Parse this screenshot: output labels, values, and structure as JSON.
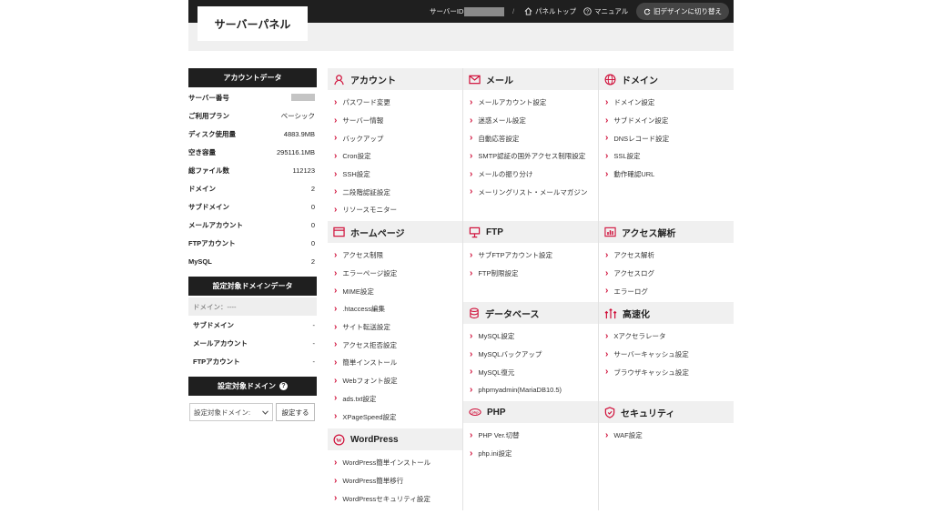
{
  "header": {
    "logo": "サーバーパネル",
    "server_id_label": "サーバーID",
    "separator": "/",
    "panel_top": "パネルトップ",
    "manual": "マニュアル",
    "old_design": "旧デザインに切り替え"
  },
  "sidebar": {
    "account_title": "アカウントデータ",
    "account_rows": [
      {
        "k": "サーバー番号",
        "v": ""
      },
      {
        "k": "ご利用プラン",
        "v": "ベーシック"
      },
      {
        "k": "ディスク使用量",
        "v": "4883.9MB"
      },
      {
        "k": "空き容量",
        "v": "295116.1MB"
      },
      {
        "k": "総ファイル数",
        "v": "112123"
      },
      {
        "k": "ドメイン",
        "v": "2"
      },
      {
        "k": "サブドメイン",
        "v": "0"
      },
      {
        "k": "メールアカウント",
        "v": "0"
      },
      {
        "k": "FTPアカウント",
        "v": "0"
      },
      {
        "k": "MySQL",
        "v": "2"
      }
    ],
    "domain_title": "設定対象ドメインデータ",
    "domain_first": "ドメイン：----",
    "domain_rows": [
      {
        "k": "サブドメイン",
        "v": "-"
      },
      {
        "k": "メールアカウント",
        "v": "-"
      },
      {
        "k": "FTPアカウント",
        "v": "-"
      }
    ],
    "target_title": "設定対象ドメイン",
    "select_value": "設定対象ドメイン:",
    "set_button": "設定する"
  },
  "sections": {
    "account": {
      "title": "アカウント",
      "items": [
        "パスワード変更",
        "サーバー情報",
        "バックアップ",
        "Cron設定",
        "SSH設定",
        "二段階認証設定",
        "リソースモニター"
      ]
    },
    "mail": {
      "title": "メール",
      "items": [
        "メールアカウント設定",
        "迷惑メール設定",
        "自動応答設定",
        "SMTP認証の国外アクセス制限設定",
        "メールの振り分け",
        "メーリングリスト・メールマガジン"
      ]
    },
    "domain": {
      "title": "ドメイン",
      "items": [
        "ドメイン設定",
        "サブドメイン設定",
        "DNSレコード設定",
        "SSL設定",
        "動作確認URL"
      ]
    },
    "homepage": {
      "title": "ホームページ",
      "items": [
        "アクセス制限",
        "エラーページ設定",
        "MIME設定",
        ".htaccess編集",
        "サイト転送設定",
        "アクセス拒否設定",
        "簡単インストール",
        "Webフォント設定",
        "ads.txt設定",
        "XPageSpeed設定"
      ]
    },
    "ftp": {
      "title": "FTP",
      "items": [
        "サブFTPアカウント設定",
        "FTP制限設定"
      ]
    },
    "access": {
      "title": "アクセス解析",
      "items": [
        "アクセス解析",
        "アクセスログ",
        "エラーログ"
      ]
    },
    "database": {
      "title": "データベース",
      "items": [
        "MySQL設定",
        "MySQLバックアップ",
        "MySQL復元",
        "phpmyadmin(MariaDB10.5)"
      ]
    },
    "speed": {
      "title": "高速化",
      "items": [
        "Xアクセラレータ",
        "サーバーキャッシュ設定",
        "ブラウザキャッシュ設定"
      ]
    },
    "php": {
      "title": "PHP",
      "items": [
        "PHP Ver.切替",
        "php.ini設定"
      ]
    },
    "security": {
      "title": "セキュリティ",
      "items": [
        "WAF設定"
      ]
    },
    "wordpress": {
      "title": "WordPress",
      "items": [
        "WordPress簡単インストール",
        "WordPress簡単移行",
        "WordPressセキュリティ設定"
      ]
    }
  },
  "colors": {
    "accent": "#d0103a",
    "dark": "#1f1f1f",
    "header_bg": "#f0f0f0"
  }
}
